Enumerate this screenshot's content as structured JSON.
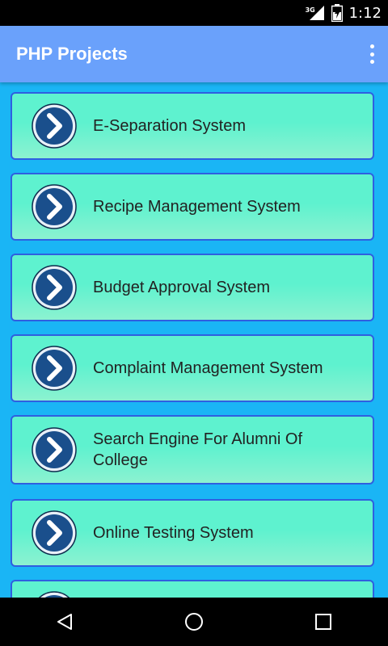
{
  "status_bar": {
    "network": "3G",
    "time": "1:12",
    "icons": [
      "signal-icon",
      "battery-icon"
    ]
  },
  "app_bar": {
    "title": "PHP Projects",
    "menu_icon": "more-vert-icon"
  },
  "projects": [
    {
      "label": "E-Separation System"
    },
    {
      "label": "Recipe Management System"
    },
    {
      "label": "Budget Approval System"
    },
    {
      "label": "Complaint Management System"
    },
    {
      "label": "Search Engine For Alumni Of College"
    },
    {
      "label": "Online Testing System"
    },
    {
      "label": ""
    }
  ],
  "nav_bar": {
    "icons": [
      "back-icon",
      "home-icon",
      "recents-icon"
    ]
  },
  "colors": {
    "background": "#1ab5f5",
    "app_bar": "#6aa1fb",
    "card_fill": "#5ef2cf",
    "card_border": "#2f5fe0",
    "arrow_icon": "#1a4f8c"
  }
}
